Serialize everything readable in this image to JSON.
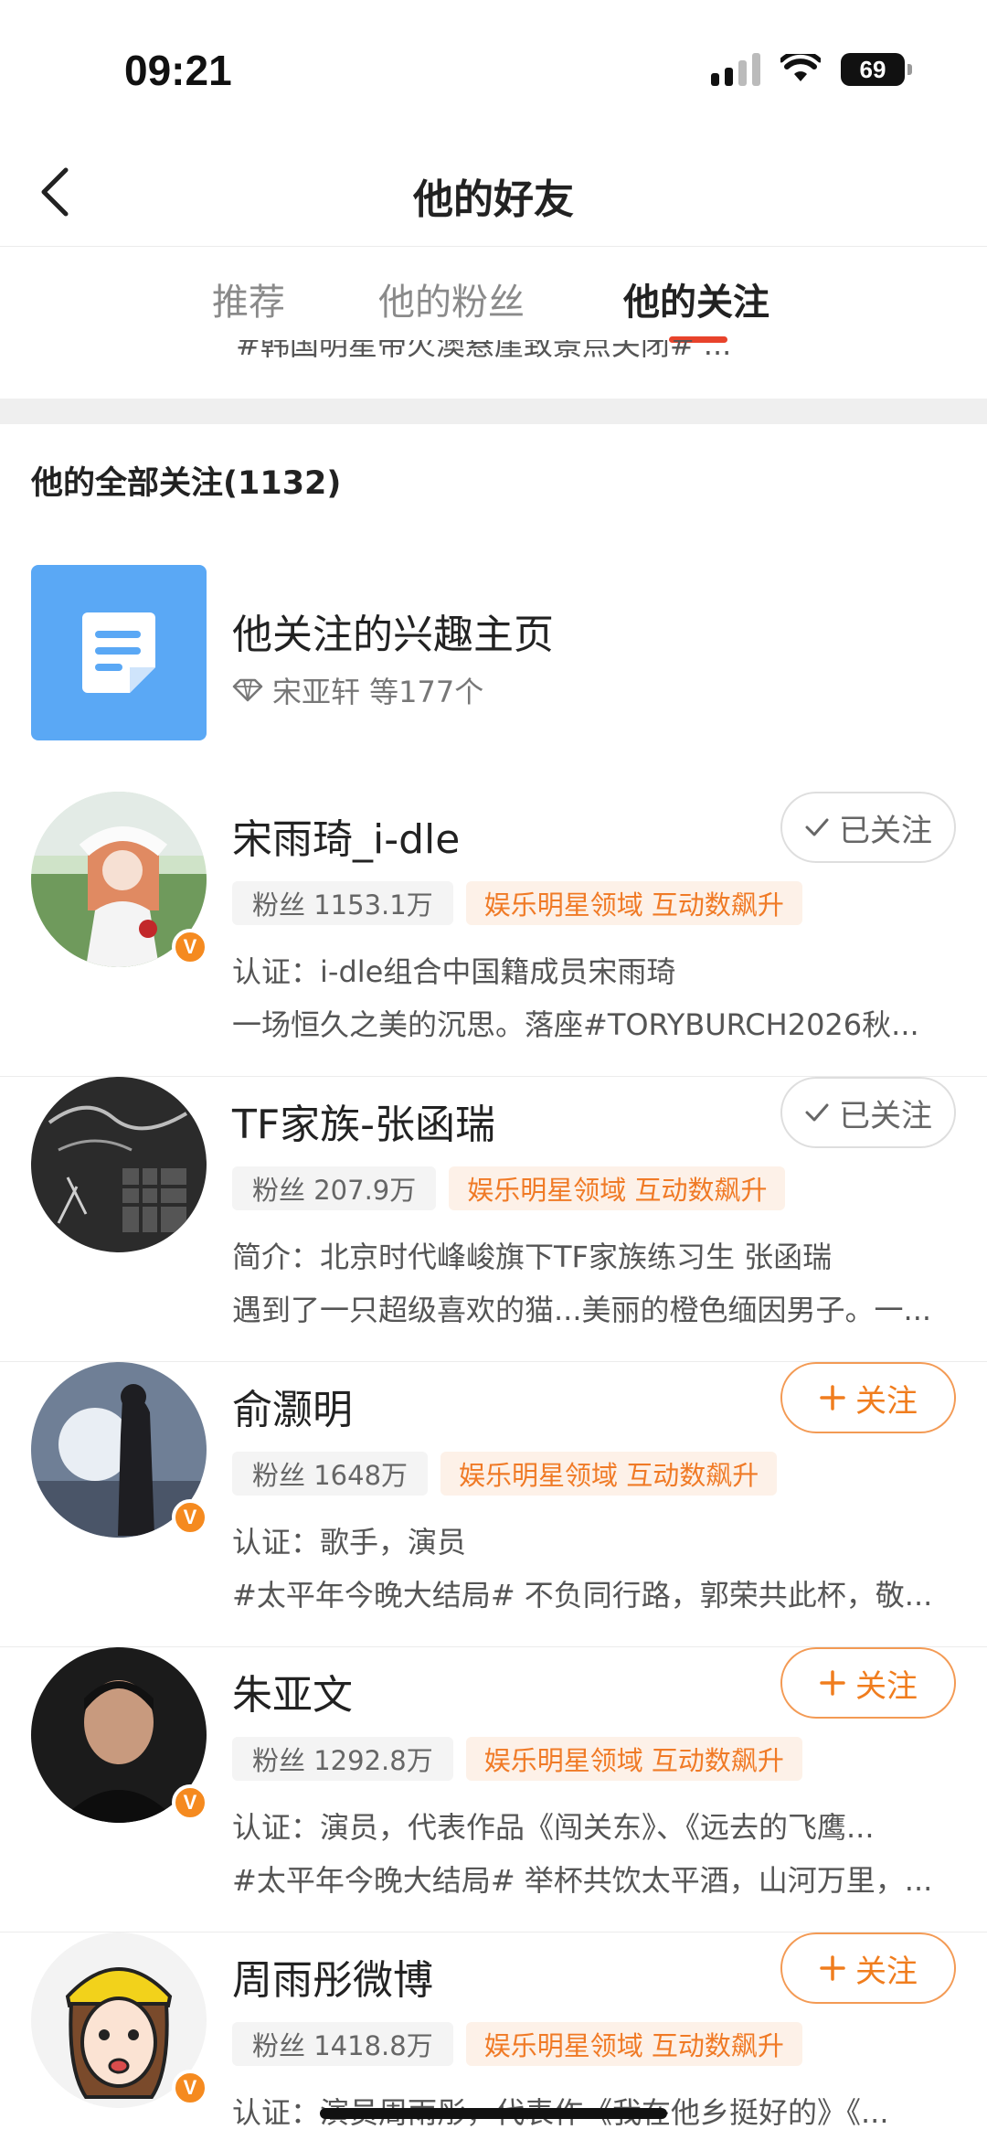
{
  "status_bar": {
    "time": "09:21",
    "battery": "69"
  },
  "nav": {
    "title": "他的好友"
  },
  "tabs": [
    {
      "label": "推荐",
      "active": false
    },
    {
      "label": "他的粉丝",
      "active": false
    },
    {
      "label": "他的关注",
      "active": true
    }
  ],
  "clipped_text": "#韩国明星带火澳悬崖致景点关闭# ...",
  "section": {
    "title": "他的全部关注(1132)"
  },
  "interest": {
    "name": "他关注的兴趣主页",
    "sub": "宋亚轩 等177个",
    "icon": "document-icon"
  },
  "users": [
    {
      "name": "宋雨琦_i-dle",
      "fans": "粉丝 1153.1万",
      "tag": "娱乐明星领域 互动数飙升",
      "line1": "认证：i-dle组合中国籍成员宋雨琦",
      "line2": "一场恒久之美的沉思。落座#TORYBURCH2026秋...",
      "button": "已关注",
      "followed": true,
      "verified": true
    },
    {
      "name": "TF家族-张函瑞",
      "fans": "粉丝 207.9万",
      "tag": "娱乐明星领域 互动数飙升",
      "line1": "简介：北京时代峰峻旗下TF家族练习生 张函瑞",
      "line2": "遇到了一只超级喜欢的猫...美丽的橙色缅因男子。一...",
      "button": "已关注",
      "followed": true,
      "verified": false
    },
    {
      "name": "俞灏明",
      "fans": "粉丝 1648万",
      "tag": "娱乐明星领域 互动数飙升",
      "line1": "认证：歌手，演员",
      "line2": "#太平年今晚大结局# 不负同行路，郭荣共此杯，敬...",
      "button": "关注",
      "followed": false,
      "verified": true
    },
    {
      "name": "朱亚文",
      "fans": "粉丝 1292.8万",
      "tag": "娱乐明星领域 互动数飙升",
      "line1": "认证：演员，代表作品《闯关东》、《远去的飞鹰...",
      "line2": "#太平年今晚大结局# 举杯共饮太平酒，山河万里，...",
      "button": "关注",
      "followed": false,
      "verified": true
    },
    {
      "name": "周雨彤微博",
      "fans": "粉丝 1418.8万",
      "tag": "娱乐明星领域 互动数飙升",
      "line1": "认证：演员周雨彤，代表作《我在他乡挺好的》《...",
      "line2": "",
      "button": "关注",
      "followed": false,
      "verified": true
    }
  ],
  "colors": {
    "accent": "#e8432b",
    "follow_orange": "#f07d1e",
    "interest_tile": "#5aa8f5"
  }
}
